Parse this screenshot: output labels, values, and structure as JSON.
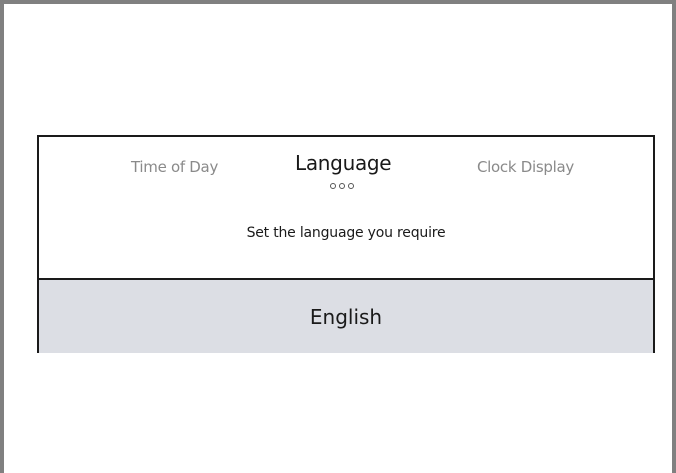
{
  "tabs": {
    "previous": "Time of Day",
    "current": "Language",
    "next": "Clock Display"
  },
  "page_indicator": {
    "dot_count": 3
  },
  "instruction": "Set the language you require",
  "selection": {
    "value": "English"
  },
  "colors": {
    "frame": "#808080",
    "selection_background": "#dcdee4",
    "inactive_tab": "#8a8a8a",
    "text": "#1a1a1a"
  }
}
